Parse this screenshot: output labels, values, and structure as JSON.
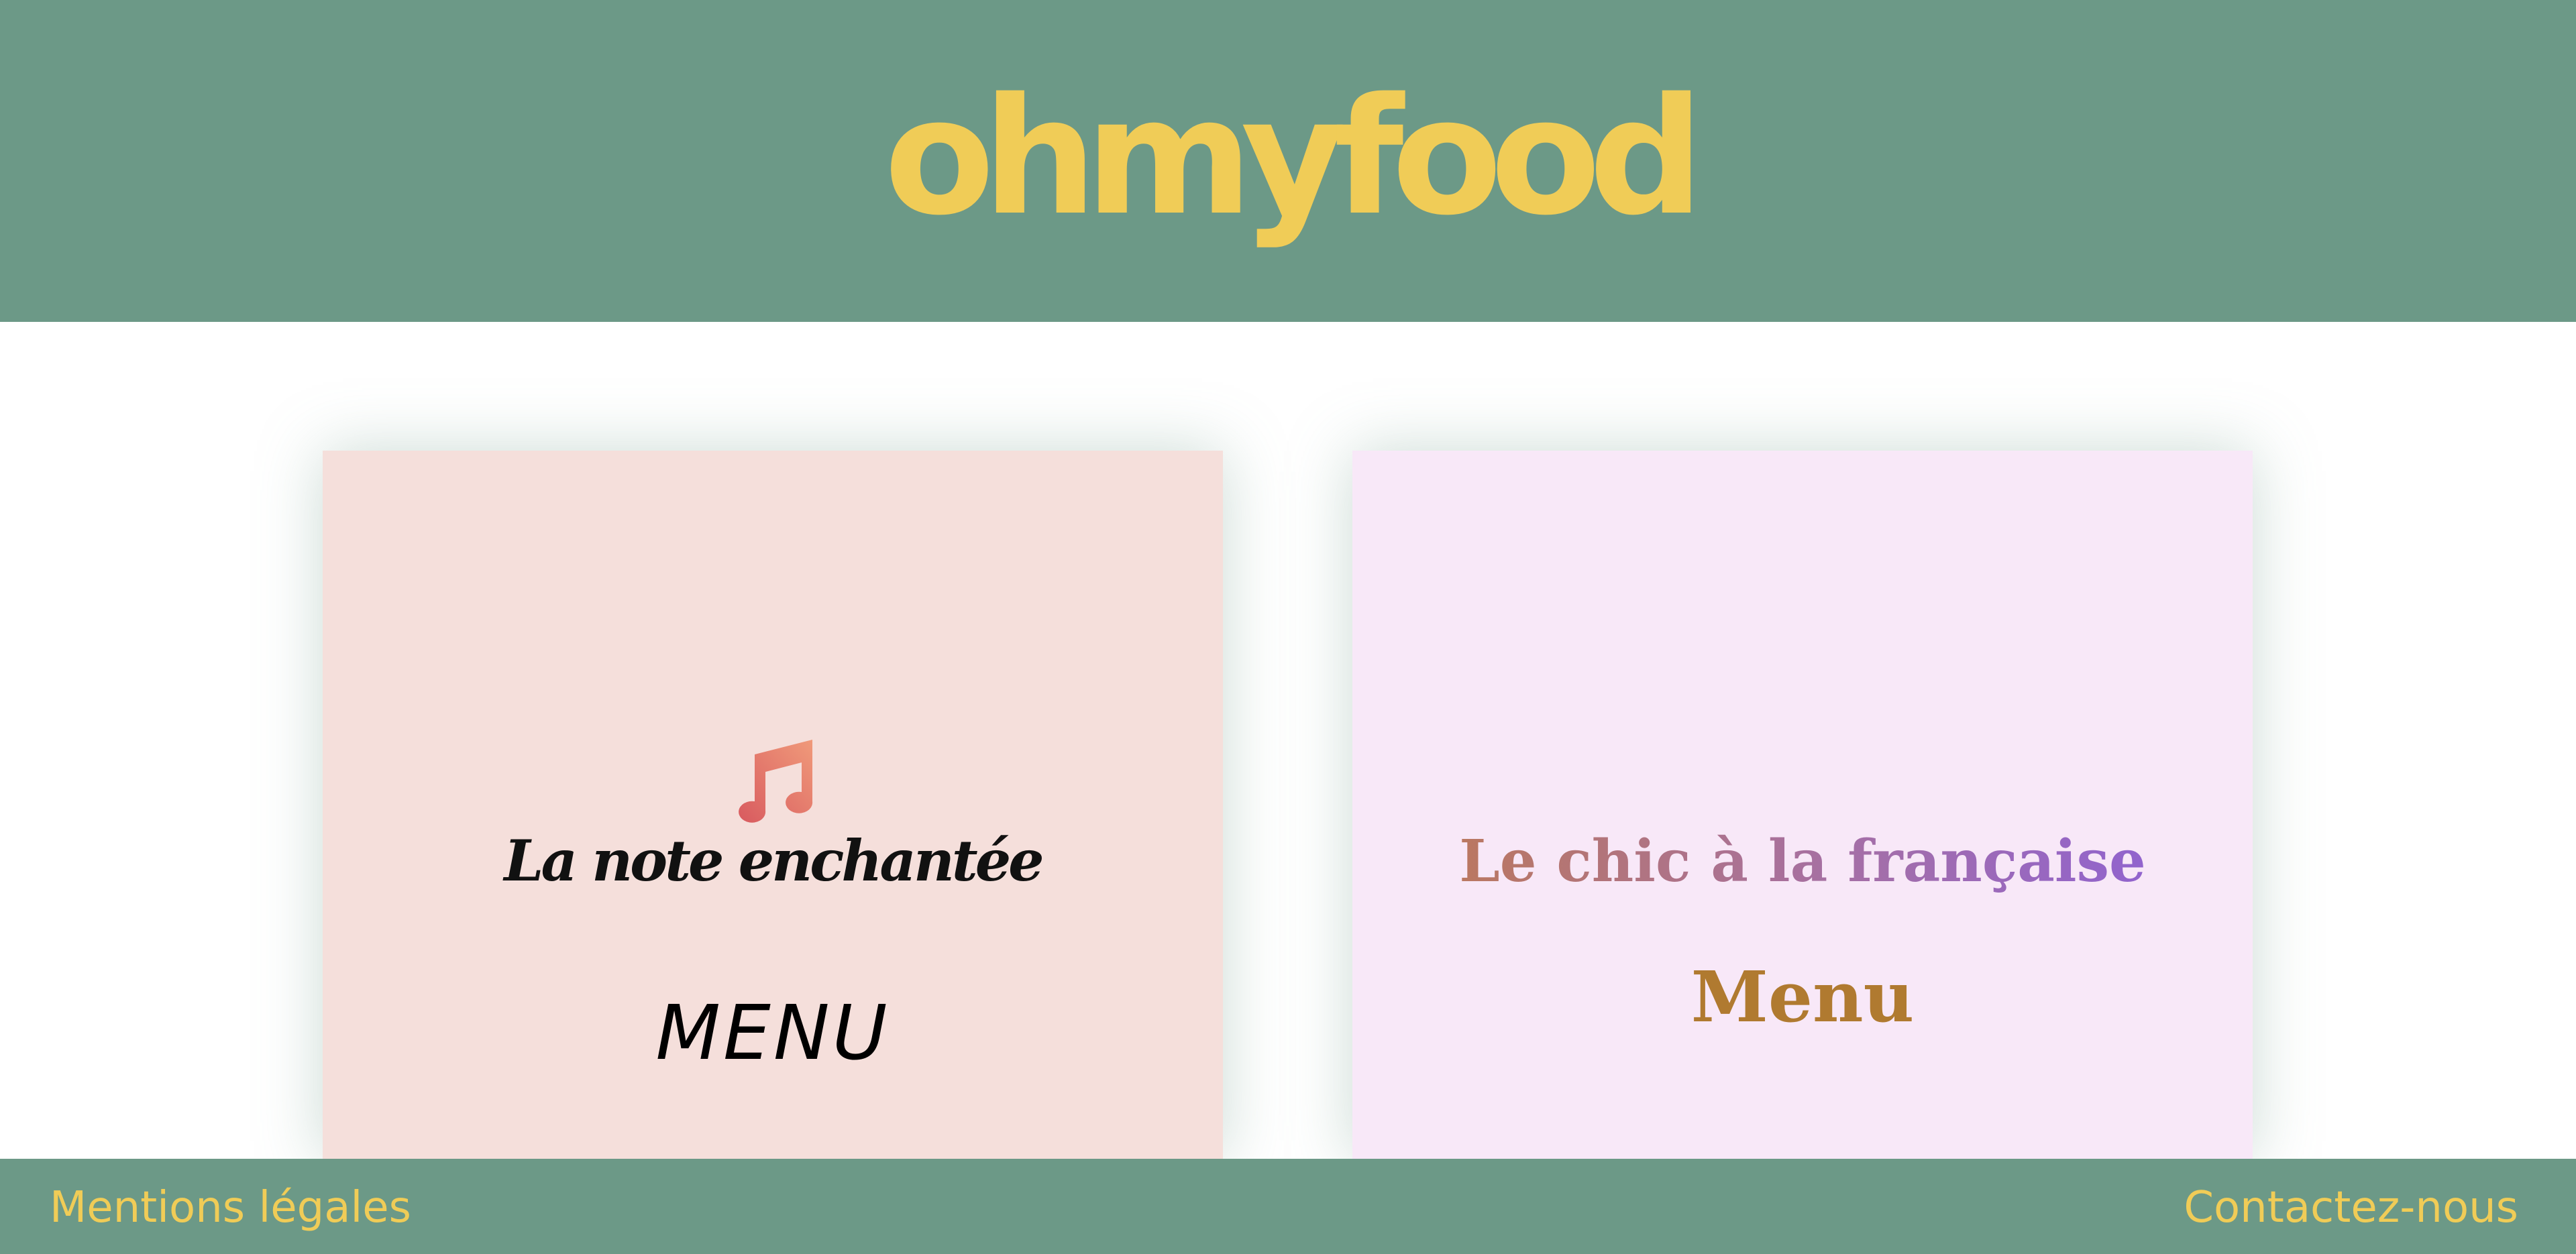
{
  "header": {
    "logo_text": "ohmyfood"
  },
  "restaurants": [
    {
      "icon": "music-note-icon",
      "name": "La note enchantée",
      "menu_label": "MENU",
      "background": "#f5dfdb"
    },
    {
      "name": "Le chic à la française",
      "menu_label": "Menu",
      "background": "#f8e8f8"
    }
  ],
  "footer": {
    "legal_label": "Mentions légales",
    "contact_label": "Contactez-nous"
  },
  "colors": {
    "brand_green": "#6c9987",
    "brand_yellow": "#f0cc57",
    "menu_gold": "#b07a30"
  }
}
